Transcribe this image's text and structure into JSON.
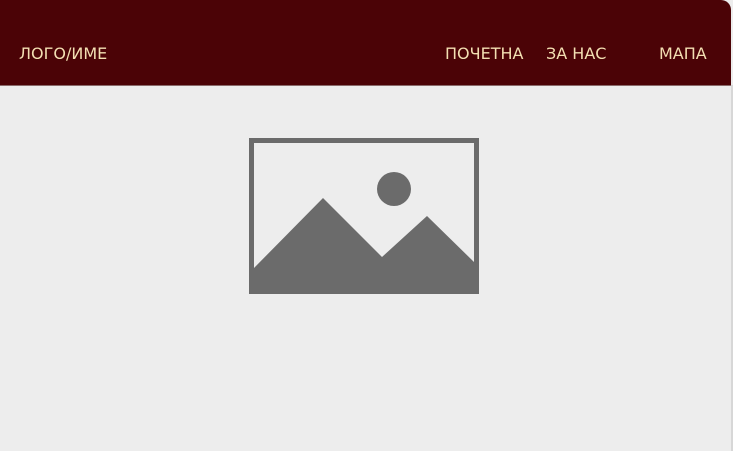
{
  "header": {
    "brand": "ЛОГО/ИМЕ",
    "nav": {
      "home": "ПОЧЕТНА",
      "about": "ЗА НАС",
      "map": "МАПА"
    }
  },
  "hero": {
    "placeholder_icon": "image-placeholder-icon"
  },
  "colors": {
    "navbar_background": "#4b0306",
    "nav_text": "#f3dfb2",
    "page_background": "#ededed",
    "placeholder_gray": "#6b6b6b"
  }
}
